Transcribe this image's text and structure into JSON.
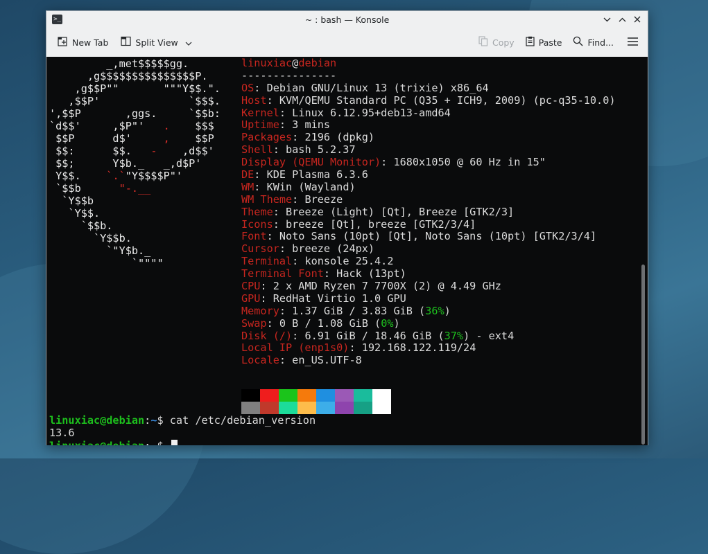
{
  "window": {
    "title": "~ : bash — Konsole"
  },
  "toolbar": {
    "new_tab": "New Tab",
    "split_view": "Split View",
    "copy": "Copy",
    "paste": "Paste",
    "find": "Find..."
  },
  "logo_lines": [
    "         _,met$$$$$gg.",
    "      ,g$$$$$$$$$$$$$$$P.",
    "    ,g$$P\"\"       \"\"\"Y$$.\".",
    "   ,$$P'              `$$$.",
    "',$$P       ,ggs.     `$$b:",
    "`d$$'     ,$P\"'   .    $$$",
    " $$P      d$'     ,    $$P",
    " $$:      $$.   -    ,d$$'",
    " $$;      Y$b._   _,d$P'",
    " Y$$.    `.`\"Y$$$$P\"'",
    " `$$b      \"-.__",
    "  `Y$$b",
    "   `Y$$.",
    "     `$$b.",
    "       `Y$$b.",
    "         `\"Y$b._",
    "             `\"\"\"\""
  ],
  "info": {
    "user": "linuxiac",
    "at": "@",
    "host": "debian",
    "separator": "---------------",
    "rows": [
      {
        "key": "OS",
        "value": "Debian GNU/Linux 13 (trixie) x86_64"
      },
      {
        "key": "Host",
        "value": "KVM/QEMU Standard PC (Q35 + ICH9, 2009) (pc-q35-10.0)"
      },
      {
        "key": "Kernel",
        "value": "Linux 6.12.95+deb13-amd64"
      },
      {
        "key": "Uptime",
        "value": "3 mins"
      },
      {
        "key": "Packages",
        "value": "2196 (dpkg)"
      },
      {
        "key": "Shell",
        "value": "bash 5.2.37"
      },
      {
        "key": "Display (QEMU Monitor)",
        "value": "1680x1050 @ 60 Hz in 15\""
      },
      {
        "key": "DE",
        "value": "KDE Plasma 6.3.6"
      },
      {
        "key": "WM",
        "value": "KWin (Wayland)"
      },
      {
        "key": "WM Theme",
        "value": "Breeze"
      },
      {
        "key": "Theme",
        "value": "Breeze (Light) [Qt], Breeze [GTK2/3]"
      },
      {
        "key": "Icons",
        "value": "breeze [Qt], breeze [GTK2/3/4]"
      },
      {
        "key": "Font",
        "value": "Noto Sans (10pt) [Qt], Noto Sans (10pt) [GTK2/3/4]"
      },
      {
        "key": "Cursor",
        "value": "breeze (24px)"
      },
      {
        "key": "Terminal",
        "value": "konsole 25.4.2"
      },
      {
        "key": "Terminal Font",
        "value": "Hack (13pt)"
      },
      {
        "key": "CPU",
        "value": "2 x AMD Ryzen 7 7700X (2) @ 4.49 GHz"
      },
      {
        "key": "GPU",
        "value": "RedHat Virtio 1.0 GPU"
      },
      {
        "key": "Memory",
        "value": "1.37 GiB / 3.83 GiB (",
        "pct": "36%",
        "tail": ")"
      },
      {
        "key": "Swap",
        "value": "0 B / 1.08 GiB (",
        "pct": "0%",
        "tail": ")"
      },
      {
        "key": "Disk (/)",
        "value": "6.91 GiB / 18.46 GiB (",
        "pct": "37%",
        "tail": ") - ext4"
      },
      {
        "key": "Local IP (enp1s0)",
        "value": "192.168.122.119/24"
      },
      {
        "key": "Locale",
        "value": "en_US.UTF-8"
      }
    ]
  },
  "palette_top": [
    "#000000",
    "#ef1d1d",
    "#1bc41b",
    "#f57a0c",
    "#1f8fe0",
    "#9b59b6",
    "#1abc9c",
    "#ffffff"
  ],
  "palette_bottom": [
    "#808080",
    "#c0392b",
    "#1cdc9a",
    "#fdbc4b",
    "#3daee9",
    "#8e44ad",
    "#16a085",
    "#ffffff"
  ],
  "session": {
    "user": "linuxiac@debian",
    "colon": ":",
    "path": "~",
    "dollar": "$",
    "command": "cat /etc/debian_version",
    "output": "13.6"
  },
  "colors": {
    "key_red": "#c7261f",
    "prompt_green": "#1dbf1d",
    "prompt_blue": "#3a87d8",
    "terminal_bg": "#0a0b0c"
  }
}
